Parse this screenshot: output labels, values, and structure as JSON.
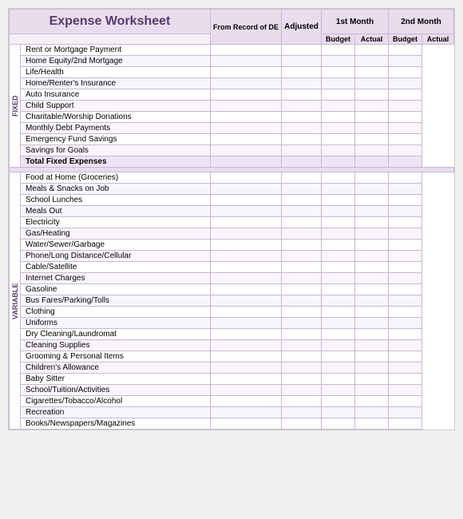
{
  "title": "Expense Worksheet",
  "header": {
    "from_record_label": "From Record of DE",
    "adjusted_label": "Adjusted",
    "month1_label": "1st Month",
    "month2_label": "2nd Month",
    "budget_label": "Budget",
    "actual_label": "Actual"
  },
  "fixed_label": "FIXED",
  "variable_label": "VARIABLE",
  "fixed_rows": [
    "Rent or Mortgage Payment",
    "Home Equity/2nd Mortgage",
    "Life/Health",
    "Home/Renter's Insurance",
    "Auto Insurance",
    "Child Support",
    "Charitable/Worship Donations",
    "Monthly Debt Payments",
    "Emergency Fund Savings",
    "Savings for Goals",
    "Total Fixed Expenses"
  ],
  "variable_rows": [
    "Food at Home (Groceries)",
    "Meals & Snacks on Job",
    "School Lunches",
    "Meals Out",
    "Electricity",
    "Gas/Heating",
    "Water/Sewer/Garbage",
    "Phone/Long Distance/Cellular",
    "Cable/Satellite",
    "Internet Charges",
    "Gasoline",
    "Bus Fares/Parking/Tolls",
    "Clothing",
    "Uniforms",
    "Dry Cleaning/Laundromat",
    "Cleaning Supplies",
    "Grooming & Personal Items",
    "Children's Allowance",
    "Baby Sitter",
    "School/Tuition/Activities",
    "Cigarettes/Tobacco/Alcohol",
    "Recreation",
    "Books/Newspapers/Magazines"
  ]
}
